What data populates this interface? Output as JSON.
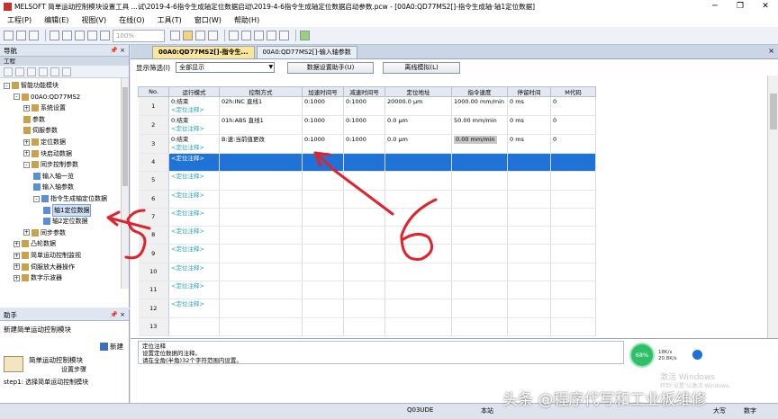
{
  "window": {
    "title": "MELSOFT 简单运动控制模块设置工具 ...试\\2019-4-6指令生成轴定位数据启动\\2019-4-6指令生成轴定位数据启动参数.pcw - [00A0:QD77MS2[]-指令生成轴·轴1定位数据]",
    "minimize": "─",
    "restore": "❐",
    "close": "✕"
  },
  "menu": [
    "工程(P)",
    "编辑(E)",
    "视图(V)",
    "在线(O)",
    "工具(T)",
    "窗口(W)",
    "帮助(H)"
  ],
  "toolbar": {
    "zoom": "100%"
  },
  "nav": {
    "header": "导航",
    "pin": "📌 ×",
    "project_label": "工程",
    "tree": [
      {
        "label": "智能功能模块",
        "level": 0,
        "exp": "-"
      },
      {
        "label": "00A0:QD77MS2",
        "level": 1,
        "exp": "-"
      },
      {
        "label": "系统设置",
        "level": 2,
        "exp": "+"
      },
      {
        "label": "参数",
        "level": 2,
        "exp": ""
      },
      {
        "label": "伺服参数",
        "level": 2,
        "exp": ""
      },
      {
        "label": "定位数据",
        "level": 2,
        "exp": "+"
      },
      {
        "label": "块启动数据",
        "level": 2,
        "exp": "+"
      },
      {
        "label": "同步控制参数",
        "level": 2,
        "exp": "-"
      },
      {
        "label": "输入轴一览",
        "level": 3,
        "exp": ""
      },
      {
        "label": "输入轴参数",
        "level": 3,
        "exp": ""
      },
      {
        "label": "指令生成轴定位数据",
        "level": 3,
        "exp": "-"
      },
      {
        "label": "轴1定位数据",
        "level": 4,
        "exp": "",
        "selected": true
      },
      {
        "label": "轴2定位数据",
        "level": 4,
        "exp": ""
      },
      {
        "label": "同步参数",
        "level": 2,
        "exp": "+"
      },
      {
        "label": "凸轮数据",
        "level": 1,
        "exp": "+"
      },
      {
        "label": "简单运动控制监视",
        "level": 1,
        "exp": "+"
      },
      {
        "label": "伺服放大器操作",
        "level": 1,
        "exp": "+"
      },
      {
        "label": "数字示波器",
        "level": 1,
        "exp": "+"
      }
    ]
  },
  "help": {
    "header": "助手",
    "pin": "📌 ×",
    "title": "新建简单运动控制模块",
    "new_label": "新建",
    "item_title": "简单运动控制模块",
    "item_sub": "设置步骤",
    "step1": "step1: 选择简单运动控制模块"
  },
  "tabs": [
    {
      "label": "00A0:QD77MS2[]-指令生...",
      "active": true
    },
    {
      "label": "00A0:QD77MS2[]-输入轴参数",
      "active": false
    }
  ],
  "tabs_close": "×",
  "filter": {
    "label": "显示筛选(I)",
    "value": "全部显示",
    "btn_setup": "数据设置助手(U)",
    "btn_offline": "离线模拟(L)"
  },
  "grid": {
    "columns": [
      "No.",
      "运行模式",
      "控制方式",
      "加速时间号",
      "减速时间号",
      "定位地址",
      "指令速度",
      "停留时间",
      "M代码"
    ],
    "rows": [
      {
        "no": "1",
        "mode": "0:结束",
        "ctrl": "02h:INC 直线1",
        "acc": "0:1000",
        "dec": "0:1000",
        "addr": "20000.0 µm",
        "speed": "1000.00 mm/min",
        "dwell": "0 ms",
        "m": "0",
        "comment": "<定位注释>",
        "speed_gray": false
      },
      {
        "no": "2",
        "mode": "0:结束",
        "ctrl": "01h:ABS 直线1",
        "acc": "0:1000",
        "dec": "0:1000",
        "addr": "0.0 µm",
        "speed": "50.00 mm/min",
        "dwell": "0 ms",
        "m": "0",
        "comment": "<定位注释>",
        "speed_gray": false
      },
      {
        "no": "3",
        "mode": "0:结束",
        "ctrl": "B:速:当前值更改",
        "acc": "0:1000",
        "dec": "0:1000",
        "addr": "0.0 µm",
        "speed": "0.00 mm/min",
        "dwell": "0 ms",
        "m": "0",
        "comment": "<定位注释>",
        "speed_gray": true
      },
      {
        "no": "4",
        "comment": "<定位注释>"
      },
      {
        "no": "5",
        "comment": "<定位注释>"
      },
      {
        "no": "6",
        "comment": "<定位注释>"
      },
      {
        "no": "7",
        "comment": "<定位注释>"
      },
      {
        "no": "8",
        "comment": "<定位注释>"
      },
      {
        "no": "9",
        "comment": "<定位注释>"
      },
      {
        "no": "10",
        "comment": "<定位注释>"
      },
      {
        "no": "11",
        "comment": "<定位注释>"
      },
      {
        "no": "12",
        "comment": "<定位注释>"
      },
      {
        "no": "13",
        "comment": ""
      }
    ]
  },
  "info": {
    "line1": "定位注释",
    "line2": "设置定位数据的注释。",
    "line3": "请在全角(半角)32个字符范围内设置。"
  },
  "netmon": {
    "pct": "68%",
    "up": "18K/s",
    "down": "20.8K/s",
    "watermark": "激活 Windows",
    "watermark2": "转到\"设置\"以激活 Windows。"
  },
  "status": {
    "module": "Q03UDE",
    "mode": "本站",
    "cap": "大写",
    "num": "数字"
  },
  "watermark": "头条 @程序代写和工业板维修",
  "annotations": {
    "mark_left": "5",
    "mark_right": "6"
  },
  "colors": {
    "selected_row": "#1f73d6",
    "comment_text": "#22a3b8",
    "active_tab": "#fbe69a",
    "annotation": "#e0222a"
  }
}
